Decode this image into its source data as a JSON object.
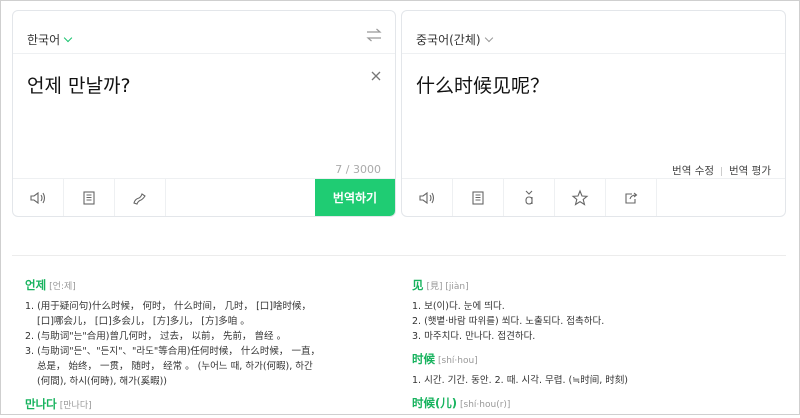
{
  "source_panel": {
    "language": "한국어",
    "text": "언제 만날까?",
    "char_count": "7 / 3000",
    "translate_button": "번역하기",
    "tools": [
      "speaker-icon",
      "book-icon",
      "pen-icon"
    ]
  },
  "target_panel": {
    "language": "중국어(간체)",
    "text": "什么时候见呢？",
    "edit_link": "번역 수정",
    "rate_link": "번역 평가",
    "tools": [
      "speaker-icon",
      "book-icon",
      "pinyin-icon",
      "star-icon",
      "share-icon"
    ]
  },
  "dictionary": {
    "left": [
      {
        "word": "언제",
        "pron": "[언:제]",
        "defs": [
          "1. (用于疑问句)什么时候， 何时， 什么时间， 几时， [口]啥时候， [口]哪会儿， [口]多会儿， [方]多儿， [方]多咱 。",
          "2. (与助词\"는\"合用)曾几何时， 过去， 以前， 先前， 曾经 。",
          "3. (与助词\"든\"、\"든지\"、\"라도\"等合用)任何时候， 什么时候， 一直， 总是， 始终， 一贯， 随时， 经常 。 (누어느 때, 하가(何暇), 하간(何間), 하시(何時), 해가(奚暇))"
        ]
      },
      {
        "word": "만나다",
        "pron": "[만나다]",
        "defs": []
      }
    ],
    "right": [
      {
        "word": "见",
        "pron": "[見] [jiàn]",
        "defs": [
          "1. 보(이)다. 눈에 띄다.",
          "2. (햇볕·바람 따위를) 쐬다. 노출되다. 접촉하다.",
          "3. 마주치다. 만나다. 접견하다."
        ]
      },
      {
        "word": "时候",
        "pron": "[shí·hou]",
        "defs": [
          "1. 시간. 기간. 동안.   2. 때. 시각. 무렵. (≒时间, 时刻)"
        ]
      },
      {
        "word": "时候(儿)",
        "pron": "[shí·hou(r)]",
        "defs": []
      }
    ]
  },
  "colors": {
    "accent": "#1fcc73",
    "headword": "#17b35e"
  }
}
